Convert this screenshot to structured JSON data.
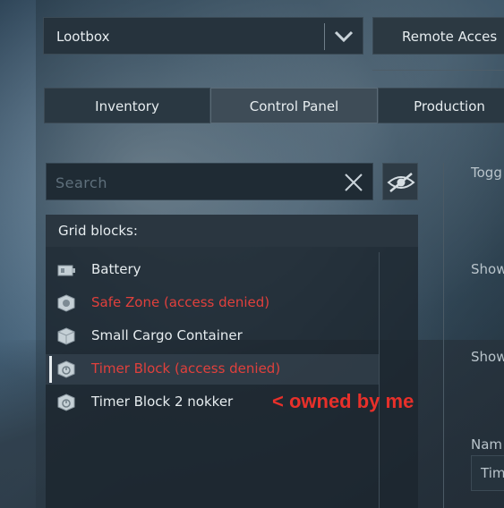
{
  "dropdown": {
    "label": "Lootbox"
  },
  "top_right": {
    "remote_access_label": "Remote Acces"
  },
  "tabs": [
    {
      "label": "Inventory"
    },
    {
      "label": "Control Panel"
    },
    {
      "label": "Production"
    }
  ],
  "search": {
    "placeholder": "Search",
    "value": ""
  },
  "grid": {
    "header": "Grid blocks:",
    "items": [
      {
        "label": "Battery",
        "denied": false
      },
      {
        "label": "Safe Zone (access denied)",
        "denied": true
      },
      {
        "label": "Small Cargo Container",
        "denied": false
      },
      {
        "label": "Timer Block (access denied)",
        "denied": true,
        "selected": true
      },
      {
        "label": "Timer Block 2 nokker",
        "denied": false
      }
    ]
  },
  "annotation": "< owned by me",
  "right_panel": {
    "labels": [
      "Togg",
      "Show",
      "Show",
      "Nam"
    ],
    "name_value": "Tim"
  },
  "colors": {
    "denied": "#e0403c",
    "annotation": "#e8302a",
    "text": "#e6ecef"
  }
}
